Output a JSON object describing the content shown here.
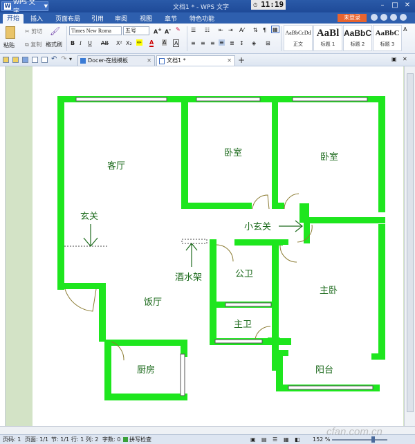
{
  "titlebar": {
    "app_label": "WPS 文字",
    "window_title": "文档1 * - WPS 文字",
    "clock": "11:19"
  },
  "menu": {
    "tabs": [
      "开始",
      "插入",
      "页面布局",
      "引用",
      "审阅",
      "视图",
      "章节",
      "特色功能"
    ],
    "login_label": "未登录"
  },
  "ribbon": {
    "paste_label": "粘贴",
    "cut_label": "剪切",
    "copy_label": "复制",
    "format_painter_label": "格式刷",
    "font_name": "Times New Roma",
    "font_size": "五号",
    "styles": [
      {
        "sample": "AaBbCcDd",
        "name": "正文"
      },
      {
        "sample": "AaBl",
        "name": "标题 1"
      },
      {
        "sample": "AaBbC",
        "name": "标题 2"
      },
      {
        "sample": "AaBbC",
        "name": "标题 3"
      }
    ]
  },
  "doctabs": [
    {
      "label": "Docer-在线模板"
    },
    {
      "label": "文档1 *"
    }
  ],
  "floorplan": {
    "rooms": {
      "living": "客厅",
      "bedroom1": "卧室",
      "bedroom2": "卧室",
      "entrance": "玄关",
      "small_entrance": "小玄关",
      "wine_rack": "酒水架",
      "public_bath": "公卫",
      "dining": "饭厅",
      "master_bedroom": "主卧",
      "master_bath": "主卫",
      "kitchen": "厨房",
      "balcony": "阳台"
    },
    "wall_color": "#1ee61e",
    "label_color": "#1d6b1d"
  },
  "status": {
    "page": "页码: 1",
    "pages": "页面: 1/1",
    "section": "节: 1/1",
    "row": "行: 1",
    "col": "列: 2",
    "wordcount": "字数: 0",
    "spellcheck": "拼写检查",
    "zoom": "152 %"
  },
  "watermark": "cfan.com.cn"
}
